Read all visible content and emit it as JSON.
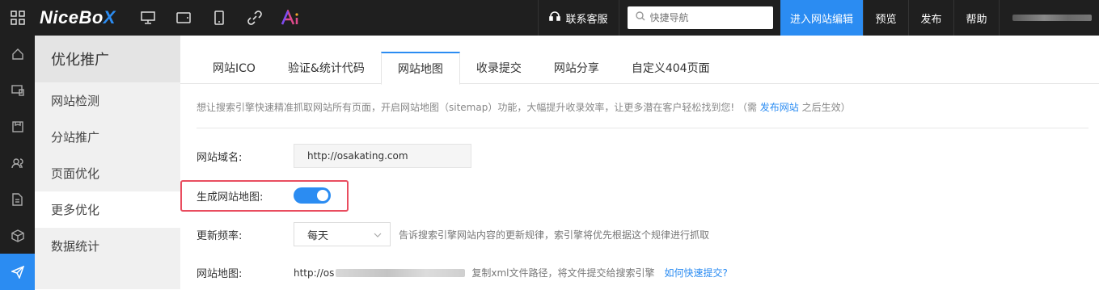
{
  "topbar": {
    "logo_main": "NiceBo",
    "logo_accent": "X",
    "service_label": "联系客服",
    "search_placeholder": "快捷导航",
    "enter_editor": "进入网站编辑",
    "preview": "预览",
    "publish": "发布",
    "help": "帮助",
    "icons": [
      "grid-icon",
      "desktop-icon",
      "tablet-icon",
      "phone-icon",
      "link-icon",
      "ai-icon"
    ]
  },
  "rail": {
    "icons": [
      "home-icon",
      "site-icon",
      "template-icon",
      "users-icon",
      "document-icon",
      "package-icon",
      "send-icon"
    ],
    "active_index": 6
  },
  "sidebar": {
    "title": "优化推广",
    "items": [
      {
        "label": "网站检测"
      },
      {
        "label": "分站推广"
      },
      {
        "label": "页面优化"
      },
      {
        "label": "更多优化"
      },
      {
        "label": "数据统计"
      }
    ],
    "active_index": 3
  },
  "tabs": [
    {
      "label": "网站ICO"
    },
    {
      "label": "验证&统计代码"
    },
    {
      "label": "网站地图"
    },
    {
      "label": "收录提交"
    },
    {
      "label": "网站分享"
    },
    {
      "label": "自定义404页面"
    }
  ],
  "active_tab": 2,
  "desc": {
    "prefix": "想让搜索引擎快速精准抓取网站所有页面，开启网站地图（sitemap）功能，大幅提升收录效率，让更多潜在客户轻松找到您!  （需",
    "link": "发布网站",
    "suffix": "之后生效）"
  },
  "form": {
    "domain_label": "网站域名:",
    "domain_value": "http://osakating.com",
    "generate_label": "生成网站地图:",
    "generate_on": true,
    "freq_label": "更新频率:",
    "freq_value": "每天",
    "freq_hint": "告诉搜索引擎网站内容的更新规律，索引擎将优先根据这个规律进行抓取",
    "sitemap_label": "网站地图:",
    "sitemap_url_prefix": "http://os",
    "sitemap_hint": "复制xml文件路径，将文件提交给搜索引擎",
    "sitemap_link": "如何快速提交?"
  },
  "colors": {
    "accent": "#2b8cf2",
    "topbar_bg": "#1f1f1f",
    "highlight_border": "#e94d5f"
  }
}
